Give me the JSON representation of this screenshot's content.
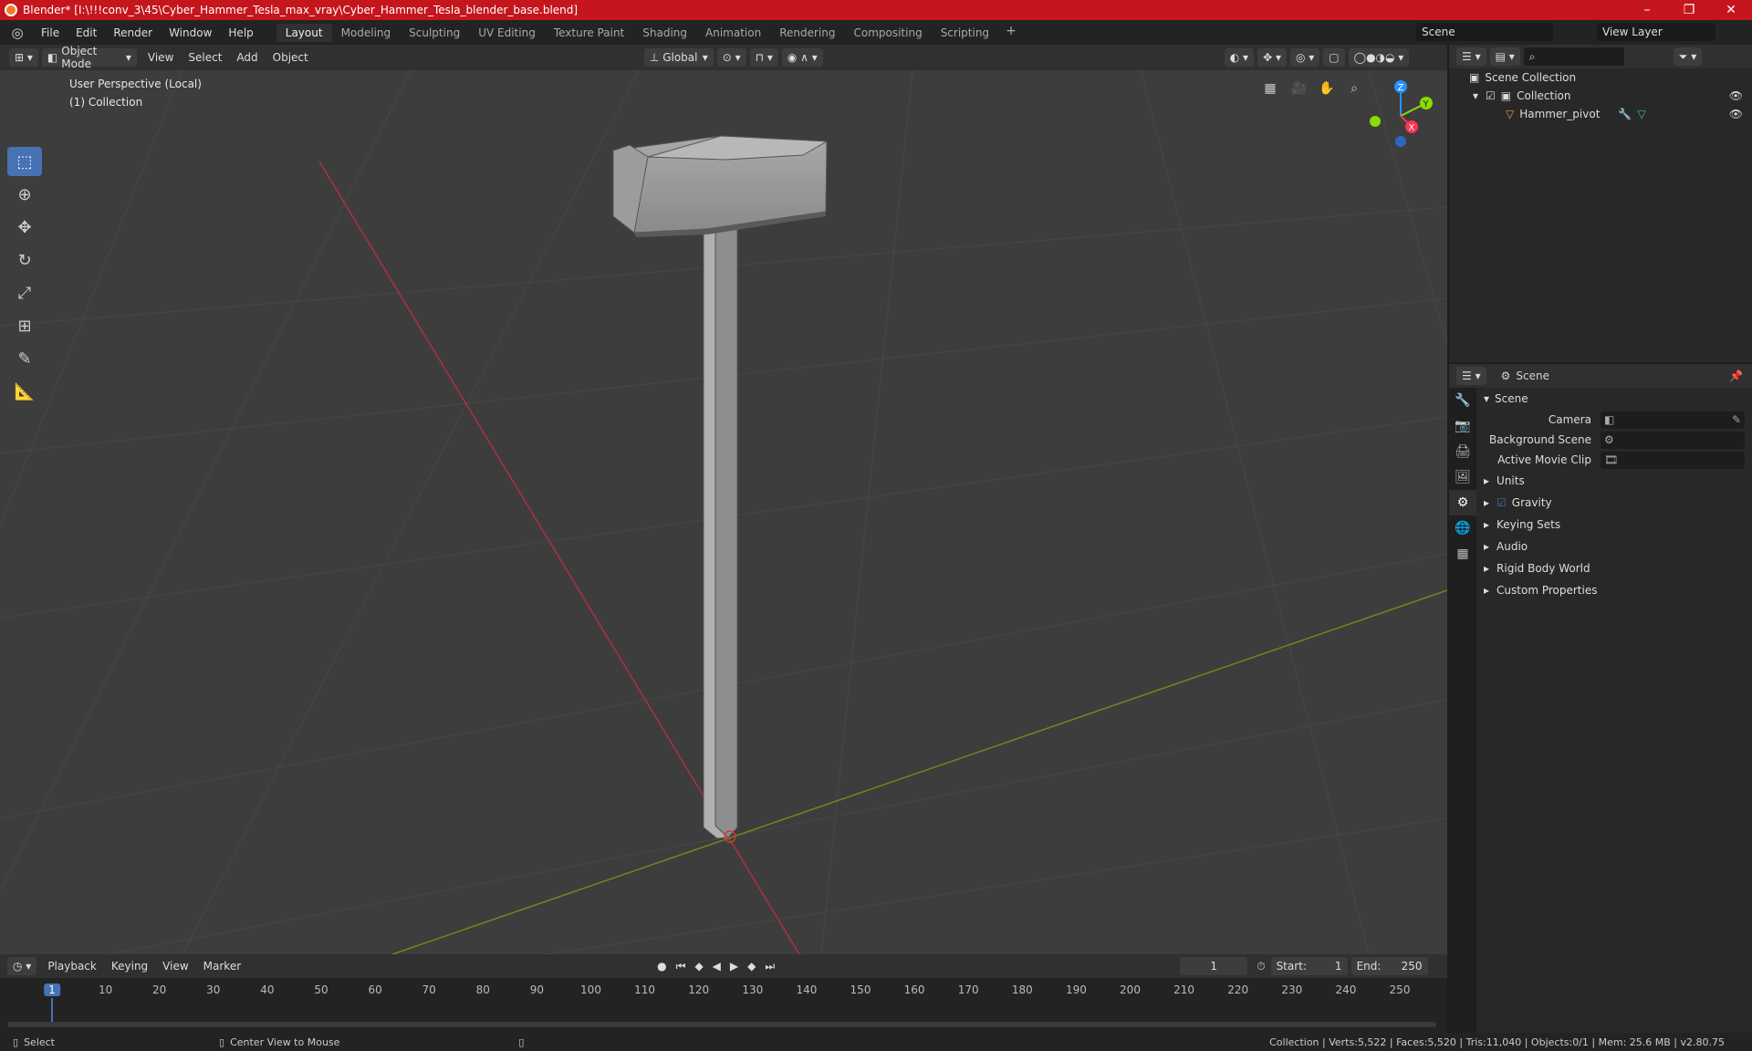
{
  "window": {
    "title": "Blender* [I:\\!!!conv_3\\45\\Cyber_Hammer_Tesla_max_vray\\Cyber_Hammer_Tesla_blender_base.blend]",
    "minimize": "–",
    "maximize": "❐",
    "close": "✕"
  },
  "menubar": {
    "items": [
      "File",
      "Edit",
      "Render",
      "Window",
      "Help"
    ]
  },
  "workspaces": {
    "tabs": [
      "Layout",
      "Modeling",
      "Sculpting",
      "UV Editing",
      "Texture Paint",
      "Shading",
      "Animation",
      "Rendering",
      "Compositing",
      "Scripting"
    ],
    "active": "Layout",
    "add": "+"
  },
  "scene": {
    "name": "Scene",
    "view_layer": "View Layer"
  },
  "viewport_header": {
    "mode": "Object Mode",
    "menus": [
      "View",
      "Select",
      "Add",
      "Object"
    ],
    "orientation": "Global"
  },
  "viewport": {
    "perspective": "User Perspective (Local)",
    "collection": "(1) Collection",
    "gizmo": {
      "x": "X",
      "y": "Y",
      "z": "Z"
    }
  },
  "outliner": {
    "root": "Scene Collection",
    "collection": "Collection",
    "object": "Hammer_pivot",
    "search_placeholder": ""
  },
  "properties": {
    "context": "Scene",
    "panel": "Scene",
    "fields": [
      {
        "label": "Camera",
        "value": ""
      },
      {
        "label": "Background Scene",
        "value": ""
      },
      {
        "label": "Active Movie Clip",
        "value": ""
      }
    ],
    "sections": [
      "Units",
      "Gravity",
      "Keying Sets",
      "Audio",
      "Rigid Body World",
      "Custom Properties"
    ]
  },
  "timeline": {
    "menus": [
      "Playback",
      "Keying",
      "View",
      "Marker"
    ],
    "current_frame": "1",
    "start_label": "Start:",
    "start": "1",
    "end_label": "End:",
    "end": "250",
    "ticks": [
      "1",
      "10",
      "20",
      "30",
      "40",
      "50",
      "60",
      "70",
      "80",
      "90",
      "100",
      "110",
      "120",
      "130",
      "140",
      "150",
      "160",
      "170",
      "180",
      "190",
      "200",
      "210",
      "220",
      "230",
      "240",
      "250"
    ]
  },
  "statusbar": {
    "select": "Select",
    "center": "Center View to Mouse",
    "stats": "Collection | Verts:5,522 | Faces:5,520 | Tris:11,040 | Objects:0/1 | Mem: 25.6 MB | v2.80.75"
  },
  "colors": {
    "titlebar": "#c4161c",
    "accent": "#4772b3",
    "x_axis": "#ff3352",
    "y_axis": "#8bdc00",
    "z_axis": "#2890ff"
  }
}
